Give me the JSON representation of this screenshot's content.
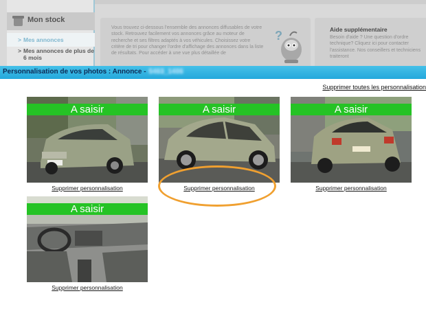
{
  "sidebar": {
    "section_title": "Mon stock",
    "items": [
      {
        "label": "Mes annonces",
        "active": true
      },
      {
        "label": "Mes annonces de plus de 6 mois",
        "active": false
      }
    ]
  },
  "info_panel": {
    "text": "Vous trouvez ci-dessous l'ensemble des annonces diffusables de votre stock. Retrouvez facilement vos annonces grâce au moteur de recherche et ses filtres adaptés à vos véhicules. Choisissez votre critère de tri pour changer l'ordre d'affichage des annonces dans la liste de résultats. Pour accéder à une vue plus détaillée de"
  },
  "help_panel": {
    "title": "Aide supplémentaire",
    "text": "Besoin d'aide ? Une question d'ordre technique? Cliquez ici pour contacter l'assistance. Nos conseillers et techniciens traiteront"
  },
  "modal": {
    "title": "Personnalisation de vos photos : Annonce -",
    "annonce_id": "5463_1406",
    "delete_all_label": "Supprimer toutes les personnalisation"
  },
  "photos": [
    {
      "badge": "A saisir",
      "remove_label": "Supprimer personnalisation",
      "subject": "car-front-three-quarter"
    },
    {
      "badge": "A saisir",
      "remove_label": "Supprimer personnalisation",
      "subject": "car-side"
    },
    {
      "badge": "A saisir",
      "remove_label": "Supprimer personnalisation",
      "subject": "car-rear"
    },
    {
      "badge": "A saisir",
      "remove_label": "Supprimer personnalisation",
      "subject": "car-interior"
    }
  ],
  "colors": {
    "modal_bar": "#24a8dc",
    "badge": "#25c325",
    "annotation": "#f0a030"
  }
}
